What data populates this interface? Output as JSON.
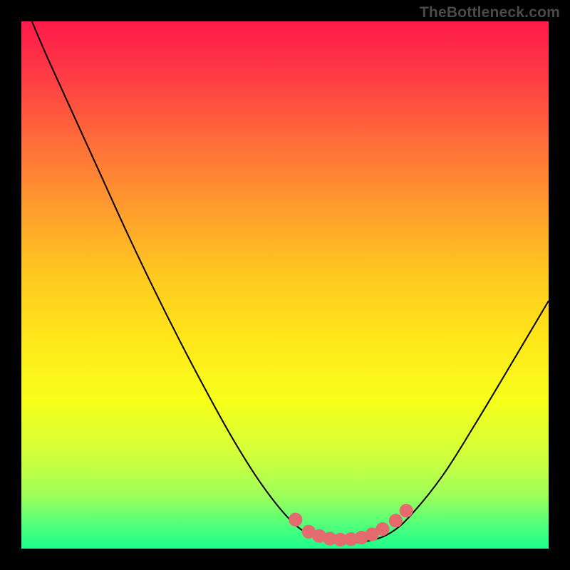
{
  "watermark": "TheBottleneck.com",
  "colors": {
    "frame": "#000000",
    "curve": "#000000",
    "marker": "#e56a6e",
    "marker_stroke": "#e56a6e",
    "gradient_stops": [
      {
        "offset": 0.0,
        "color": "#ff1a4b"
      },
      {
        "offset": 0.1,
        "color": "#ff3a45"
      },
      {
        "offset": 0.22,
        "color": "#ff6a3a"
      },
      {
        "offset": 0.35,
        "color": "#ff9a2e"
      },
      {
        "offset": 0.48,
        "color": "#ffc81f"
      },
      {
        "offset": 0.6,
        "color": "#ffe61a"
      },
      {
        "offset": 0.72,
        "color": "#f7ff1a"
      },
      {
        "offset": 0.82,
        "color": "#d2ff3a"
      },
      {
        "offset": 0.9,
        "color": "#9dff5a"
      },
      {
        "offset": 0.96,
        "color": "#4bff7d"
      },
      {
        "offset": 1.0,
        "color": "#1cff8c"
      }
    ]
  },
  "chart_data": {
    "type": "line",
    "title": "",
    "xlabel": "",
    "ylabel": "",
    "xlim": [
      0,
      100
    ],
    "ylim": [
      0,
      100
    ],
    "curve": [
      {
        "x": 2.0,
        "y": 100.0
      },
      {
        "x": 5.0,
        "y": 93.0
      },
      {
        "x": 10.0,
        "y": 82.0
      },
      {
        "x": 15.0,
        "y": 71.0
      },
      {
        "x": 20.0,
        "y": 60.0
      },
      {
        "x": 25.0,
        "y": 49.5
      },
      {
        "x": 30.0,
        "y": 39.5
      },
      {
        "x": 35.0,
        "y": 30.0
      },
      {
        "x": 40.0,
        "y": 21.0
      },
      {
        "x": 45.0,
        "y": 13.0
      },
      {
        "x": 50.0,
        "y": 6.5
      },
      {
        "x": 54.0,
        "y": 3.0
      },
      {
        "x": 58.0,
        "y": 1.5
      },
      {
        "x": 62.0,
        "y": 1.2
      },
      {
        "x": 66.0,
        "y": 1.5
      },
      {
        "x": 70.0,
        "y": 3.0
      },
      {
        "x": 74.0,
        "y": 6.5
      },
      {
        "x": 80.0,
        "y": 14.0
      },
      {
        "x": 86.0,
        "y": 23.5
      },
      {
        "x": 92.0,
        "y": 33.5
      },
      {
        "x": 100.0,
        "y": 47.0
      }
    ],
    "markers": [
      {
        "x": 52.0,
        "y": 5.5
      },
      {
        "x": 54.5,
        "y": 3.2
      },
      {
        "x": 56.5,
        "y": 2.4
      },
      {
        "x": 58.5,
        "y": 1.9
      },
      {
        "x": 60.5,
        "y": 1.7
      },
      {
        "x": 62.5,
        "y": 1.8
      },
      {
        "x": 64.5,
        "y": 2.1
      },
      {
        "x": 66.5,
        "y": 2.7
      },
      {
        "x": 68.5,
        "y": 3.7
      },
      {
        "x": 71.0,
        "y": 5.3
      },
      {
        "x": 73.0,
        "y": 7.2
      }
    ],
    "marker_radius": 1.3
  }
}
